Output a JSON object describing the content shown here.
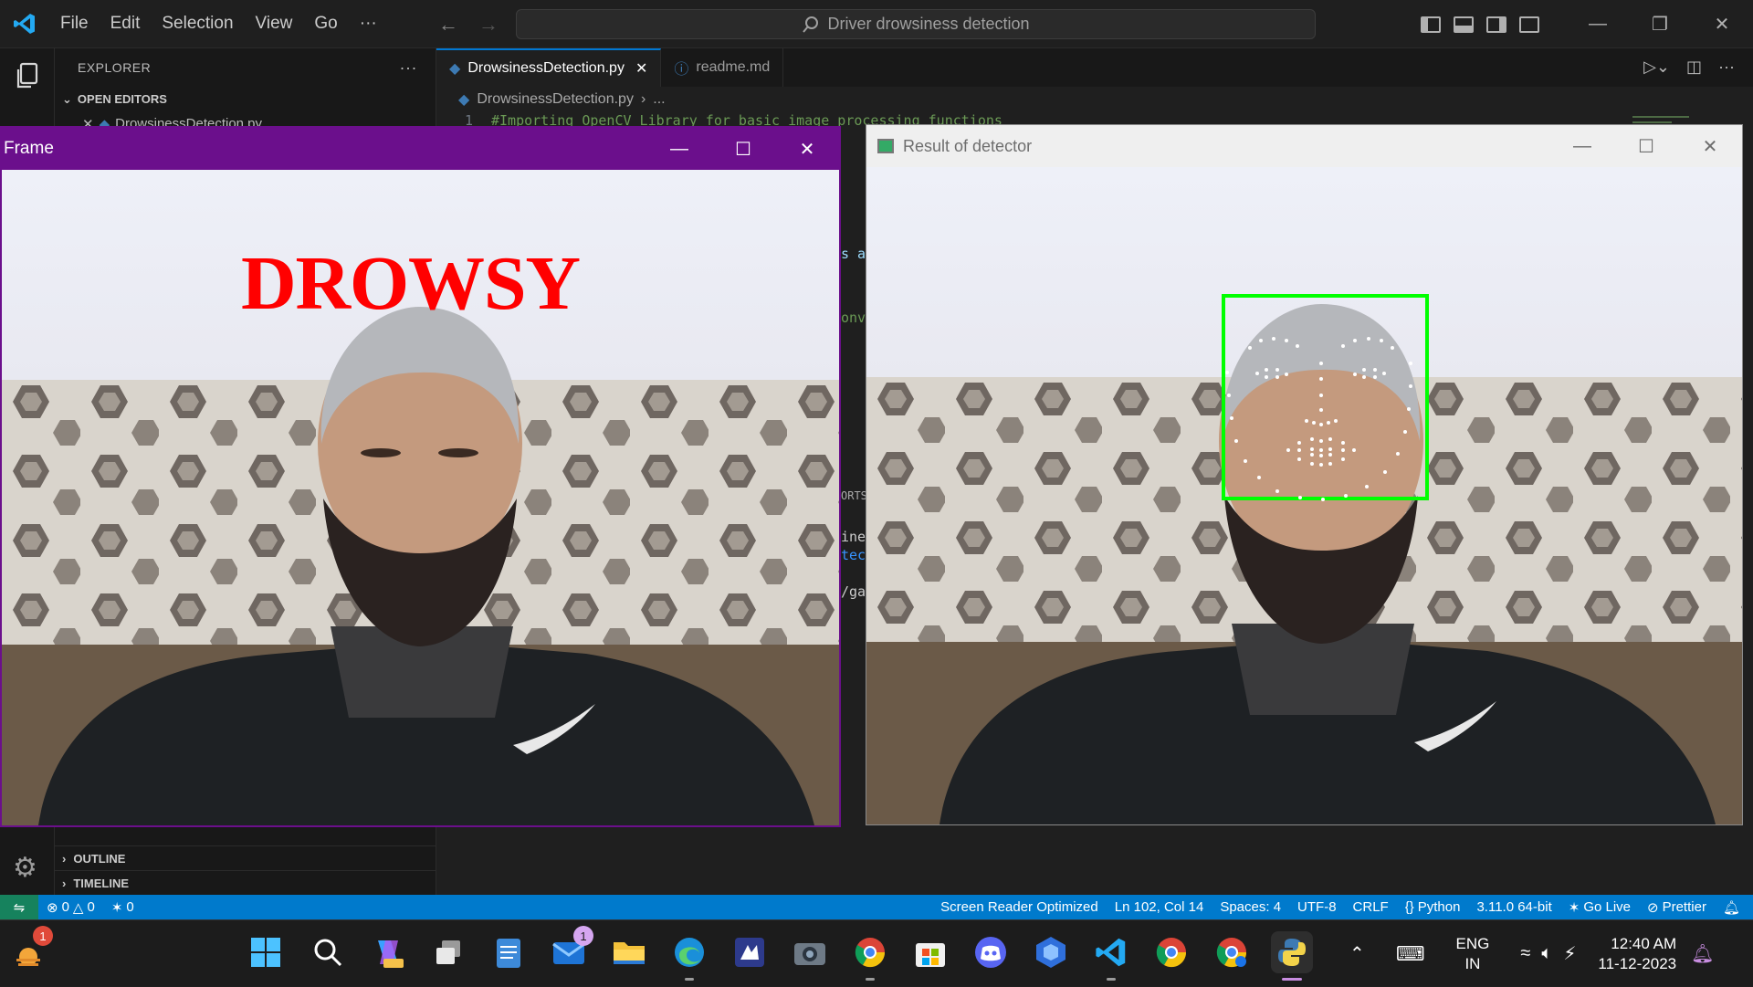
{
  "titlebar": {
    "menu": [
      "File",
      "Edit",
      "Selection",
      "View",
      "Go",
      "···"
    ],
    "search": "Driver drowsiness detection"
  },
  "sidebar": {
    "header": "EXPLORER",
    "open_editors": "OPEN EDITORS",
    "open_file": "DrowsinessDetection.py",
    "outline": "OUTLINE",
    "timeline": "TIMELINE"
  },
  "editor": {
    "tabs": [
      {
        "label": "DrowsinessDetection.py"
      },
      {
        "label": "readme.md"
      }
    ],
    "breadcrumb": [
      "DrowsinessDetection.py",
      "..."
    ],
    "line_number": "1",
    "line_text": "#Importing OpenCV Library for basic image processing functions",
    "fragments": [
      "s a",
      "onv",
      "ORTS",
      "ines",
      "tect",
      "/gar"
    ]
  },
  "frame_window": {
    "title": "Frame",
    "overlay_text": "DROWSY"
  },
  "result_window": {
    "title": "Result of detector"
  },
  "statusbar": {
    "errors": "0",
    "warnings": "0",
    "ports": "0",
    "screen_reader": "Screen Reader Optimized",
    "position": "Ln 102, Col 14",
    "spaces": "Spaces: 4",
    "encoding": "UTF-8",
    "eol": "CRLF",
    "language": "Python",
    "interpreter": "3.11.0 64-bit",
    "go_live": "Go Live",
    "prettier": "Prettier"
  },
  "taskbar": {
    "weather_badge": "1",
    "mail_badge": "1",
    "lang_top": "ENG",
    "lang_bottom": "IN",
    "time": "12:40 AM",
    "date": "11-12-2023"
  },
  "colors": {
    "accent": "#007acc",
    "frame_title": "#6b0f8c",
    "drowsy_text": "#ff0000",
    "face_box": "#00ff00"
  }
}
